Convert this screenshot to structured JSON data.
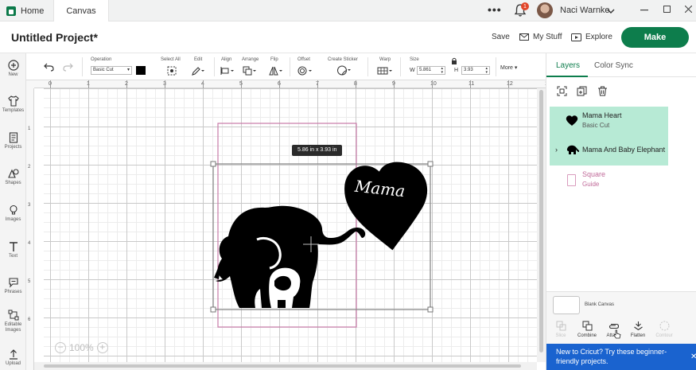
{
  "titlebar": {
    "home_label": "Home",
    "canvas_tab": "Canvas",
    "notifications_count": "1",
    "user_name": "Naci Warnke",
    "more_icon": "more-dots-icon"
  },
  "header": {
    "project_title": "Untitled Project*",
    "save": "Save",
    "my_stuff": "My Stuff",
    "explore": "Explore",
    "make": "Make"
  },
  "sidebar": {
    "items": [
      "New",
      "Templates",
      "Projects",
      "Shapes",
      "Images",
      "Text",
      "Phrases",
      "Editable Images",
      "Upload"
    ]
  },
  "toolbar": {
    "operation_label": "Operation",
    "operation_value": "Basic Cut",
    "select_all": "Select All",
    "edit": "Edit",
    "align": "Align",
    "arrange": "Arrange",
    "flip": "Flip",
    "offset": "Offset",
    "create_sticker": "Create Sticker",
    "warp": "Warp",
    "size": "Size",
    "w_label": "W",
    "w_value": "5.861",
    "h_label": "H",
    "h_value": "3.93",
    "more": "More"
  },
  "canvas": {
    "ruler_top": [
      "0",
      "1",
      "2",
      "3",
      "4",
      "5",
      "6",
      "7",
      "8",
      "9",
      "10",
      "11",
      "12",
      "13"
    ],
    "ruler_left": [
      "1",
      "2",
      "3",
      "4",
      "5",
      "6"
    ],
    "size_tooltip": "5.86  in x 3.93  in",
    "heart_text": "Mama",
    "zoom": "100%",
    "zoom_out": "−",
    "zoom_in": "+"
  },
  "layers_panel": {
    "tab_layers": "Layers",
    "tab_color_sync": "Color Sync",
    "layers": [
      {
        "name": "Mama Heart",
        "sub": "Basic Cut"
      },
      {
        "name": "Mama And Baby Elephant",
        "sub": ""
      },
      {
        "name": "Square",
        "sub": "Guide"
      }
    ],
    "blank_canvas": "Blank Canvas",
    "actions": [
      "Slice",
      "Combine",
      "Attach",
      "Flatten",
      "Contour"
    ],
    "promo": "New to Cricut? Try these beginner-friendly projects.",
    "promo_close": "✕"
  },
  "colors": {
    "brand_green": "#0d7d4c",
    "layer_selected": "#b7ead5",
    "guide_pink": "#c06a99",
    "promo_blue": "#1a63cf"
  }
}
